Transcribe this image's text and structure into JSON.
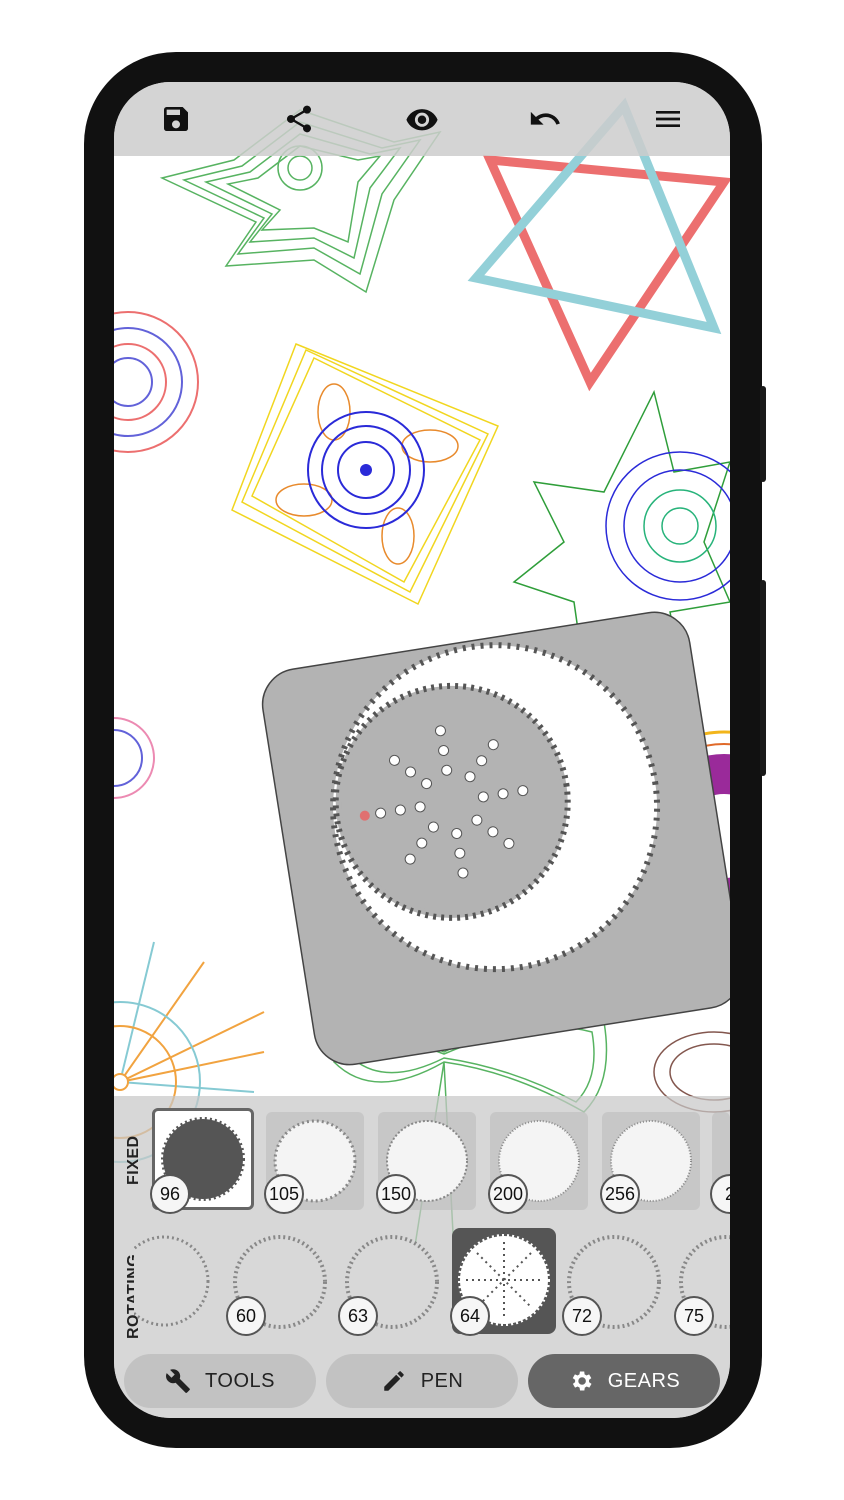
{
  "toolbar": {
    "icons": [
      "save-icon",
      "share-icon",
      "eye-icon",
      "undo-icon",
      "menu-icon"
    ]
  },
  "gears": {
    "fixed_label": "FIXED",
    "rotating_label": "ROTATING",
    "fixed": [
      "96",
      "105",
      "150",
      "200",
      "256",
      "2"
    ],
    "rotating": [
      "60",
      "63",
      "64",
      "72",
      "75"
    ],
    "selected_fixed": "96",
    "selected_rotating": "64"
  },
  "nav": {
    "tools": "TOOLS",
    "pen": "PEN",
    "gears": "GEARS"
  },
  "colors": {
    "accent_dark": "#666666",
    "panel": "#c8c8c8"
  }
}
